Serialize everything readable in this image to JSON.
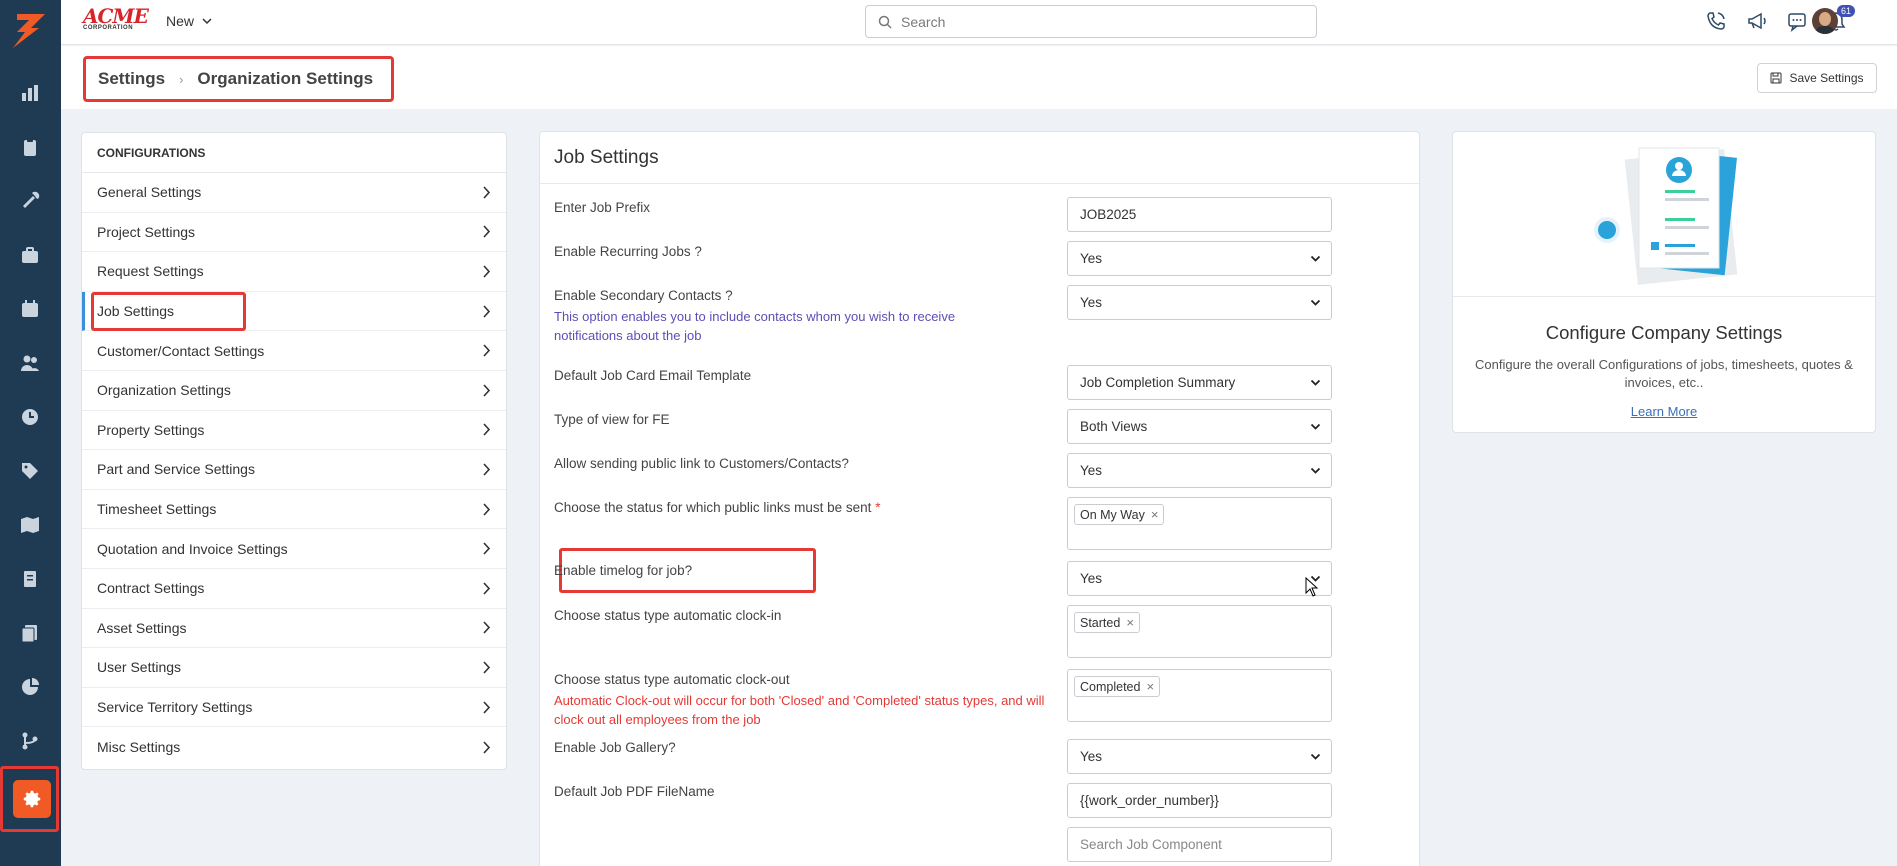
{
  "brand": {
    "line1": "ACME",
    "line2": "CORPORATION"
  },
  "topbar": {
    "new_label": "New",
    "search_placeholder": "Search",
    "notifications_count": "61"
  },
  "breadcrumb": {
    "root": "Settings",
    "current": "Organization Settings"
  },
  "save_label": "Save Settings",
  "config": {
    "header": "CONFIGURATIONS",
    "items": [
      {
        "label": "General Settings"
      },
      {
        "label": "Project Settings"
      },
      {
        "label": "Request Settings"
      },
      {
        "label": "Job Settings"
      },
      {
        "label": "Customer/Contact Settings"
      },
      {
        "label": "Organization Settings"
      },
      {
        "label": "Property Settings"
      },
      {
        "label": "Part and Service Settings"
      },
      {
        "label": "Timesheet Settings"
      },
      {
        "label": "Quotation and Invoice Settings"
      },
      {
        "label": "Contract Settings"
      },
      {
        "label": "Asset Settings"
      },
      {
        "label": "User Settings"
      },
      {
        "label": "Service Territory Settings"
      },
      {
        "label": "Misc Settings"
      }
    ]
  },
  "job": {
    "title": "Job Settings",
    "prefix": {
      "label": "Enter Job Prefix",
      "value": "JOB2025"
    },
    "recurring": {
      "label": "Enable Recurring Jobs ?",
      "value": "Yes"
    },
    "secondary": {
      "label": "Enable Secondary Contacts ?",
      "note": "This option enables you to include contacts whom you wish to receive notifications about the job",
      "value": "Yes"
    },
    "email_template": {
      "label": "Default Job Card Email Template",
      "value": "Job Completion Summary"
    },
    "view_type": {
      "label": "Type of view for FE",
      "value": "Both Views"
    },
    "public_link": {
      "label": "Allow sending public link to Customers/Contacts?",
      "value": "Yes"
    },
    "public_status": {
      "label": "Choose the status for which public links must be sent",
      "required": "*",
      "chip": "On My Way"
    },
    "timelog": {
      "label": "Enable timelog for job?",
      "value": "Yes"
    },
    "clock_in": {
      "label": "Choose status type automatic clock-in",
      "chip": "Started"
    },
    "clock_out": {
      "label": "Choose status type automatic clock-out",
      "note": "Automatic Clock-out will occur for both 'Closed' and 'Completed' status types, and will clock out all employees from the job",
      "chip": "Completed"
    },
    "gallery": {
      "label": "Enable Job Gallery?",
      "value": "Yes"
    },
    "pdf_name": {
      "label": "Default Job PDF FileName",
      "value": "{{work_order_number}}"
    },
    "component_placeholder": "Search Job Component"
  },
  "card": {
    "title": "Configure Company Settings",
    "desc": "Configure the overall Configurations of jobs, timesheets, quotes & invoices, etc..",
    "learn": "Learn More"
  },
  "colors": {
    "accent": "#f15a24",
    "rail": "#1f3a53",
    "highlight": "#e53935",
    "note_blue": "#5b4fb5"
  }
}
